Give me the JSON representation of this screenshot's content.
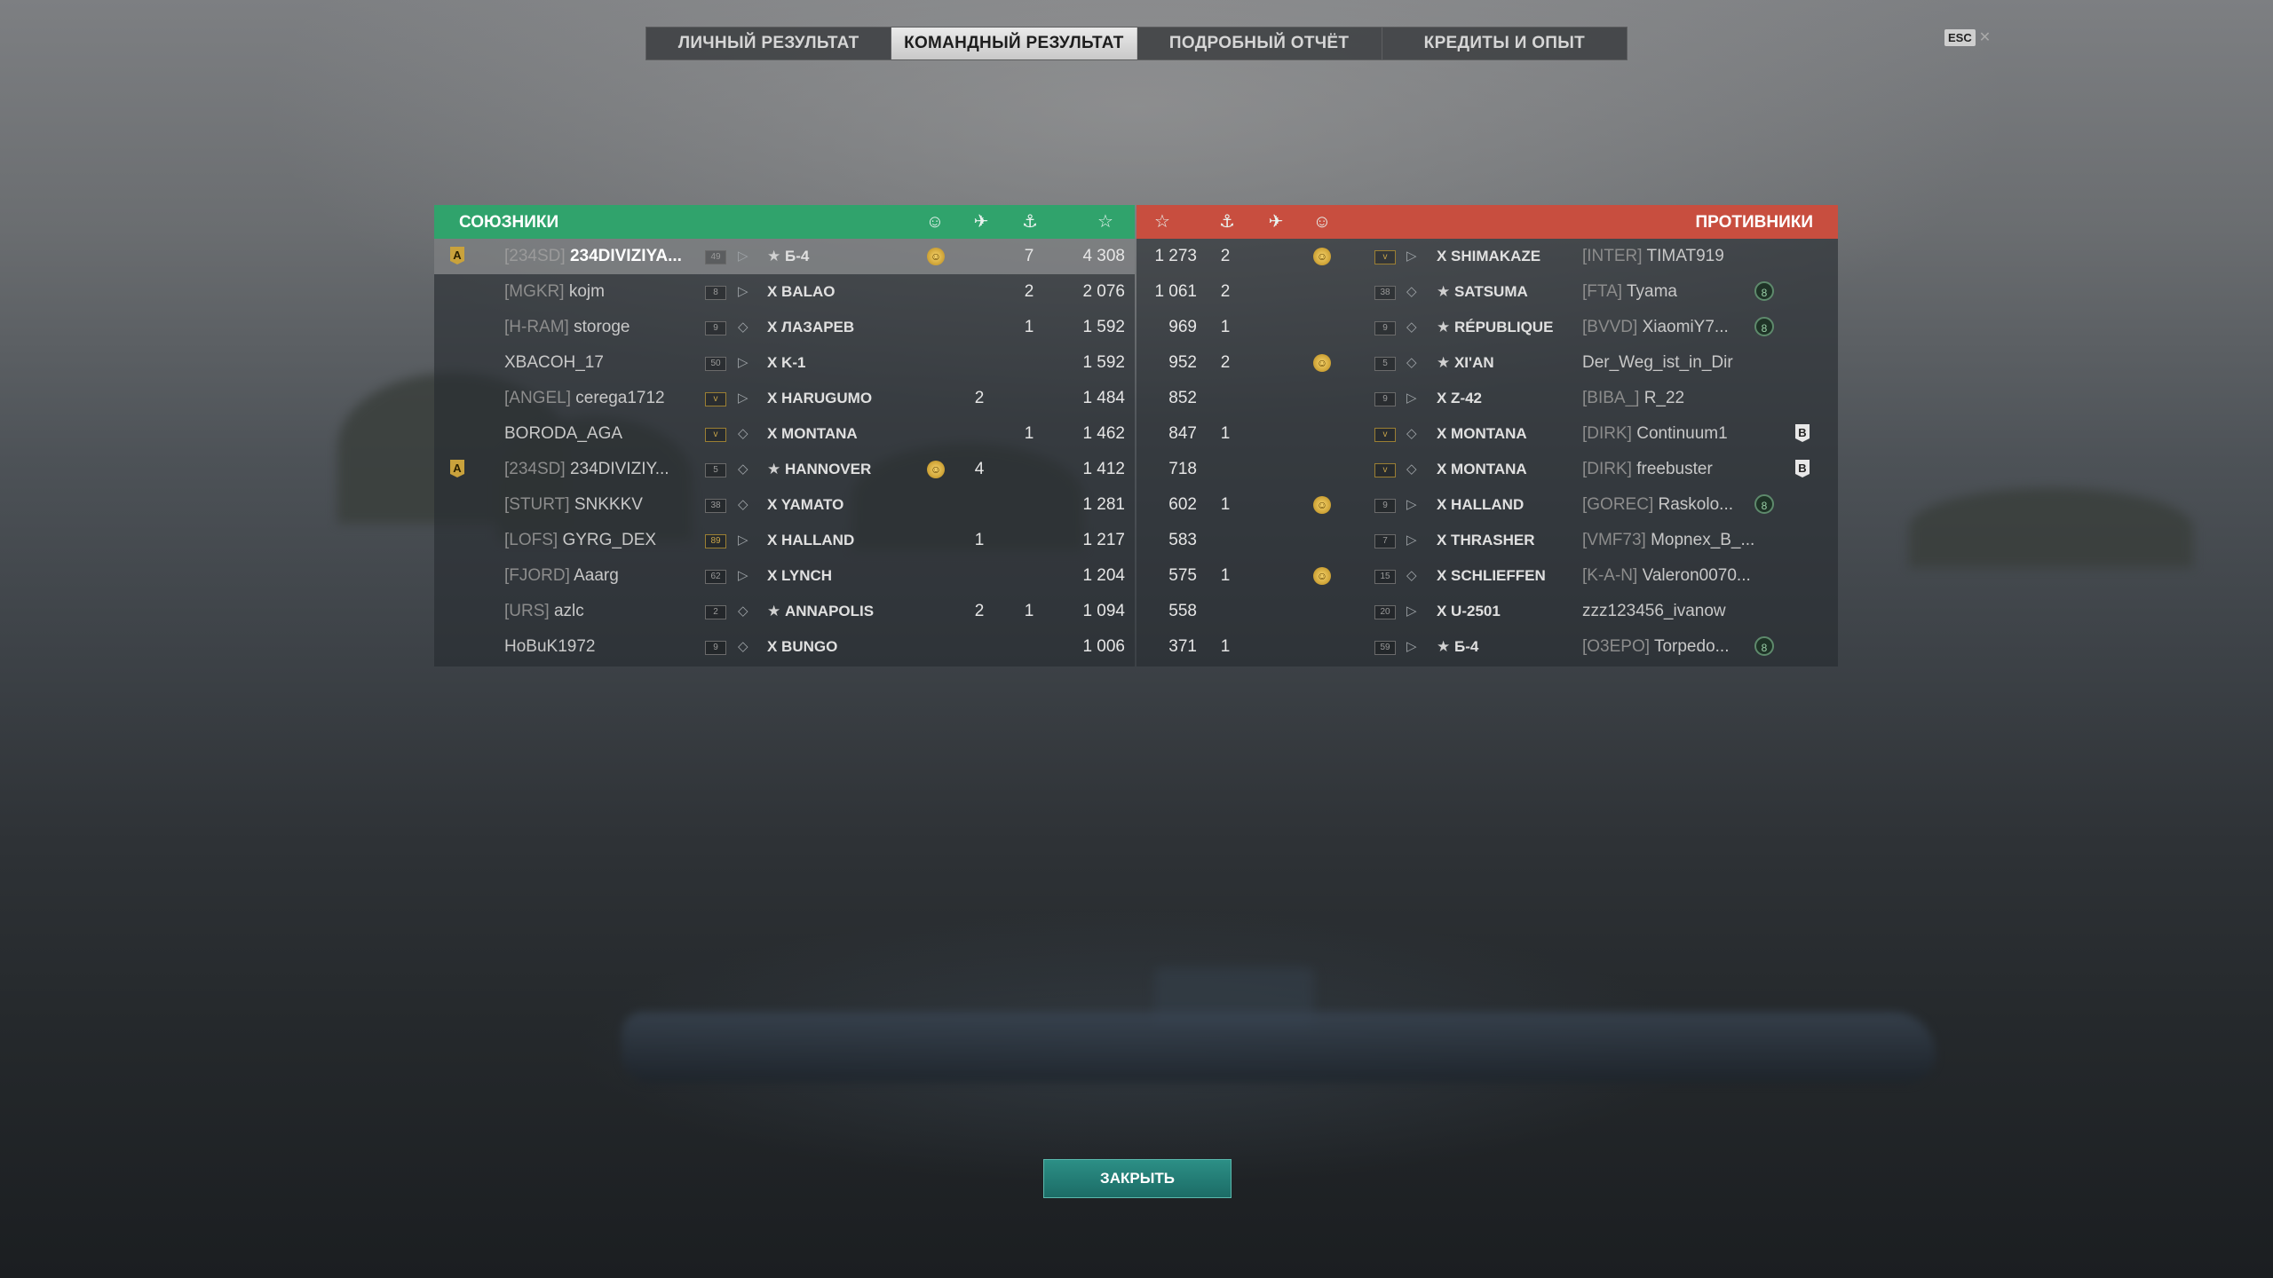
{
  "tabs": [
    {
      "label": "ЛИЧНЫЙ РЕЗУЛЬТАТ"
    },
    {
      "label": "КОМАНДНЫЙ РЕЗУЛЬТАТ"
    },
    {
      "label": "ПОДРОБНЫЙ ОТЧЁТ"
    },
    {
      "label": "КРЕДИТЫ И ОПЫТ"
    }
  ],
  "active_tab": 1,
  "esc_label": "ESC",
  "allies": {
    "title": "СОЮЗНИКИ",
    "header_icons": [
      "laurel-icon",
      "planes-icon",
      "ship-sunk-icon",
      "star-icon"
    ],
    "color": "#30a36c",
    "rows": [
      {
        "clan": "[234SD]",
        "name": "234DIVIZIYA...",
        "level": "49",
        "cls": "submarine-icon",
        "star": true,
        "ship": "Б-4",
        "laurel": true,
        "planes": "",
        "kills": "7",
        "xp": "4 308",
        "highlight": true,
        "rank": "A"
      },
      {
        "clan": "[MGKR]",
        "name": "kojm",
        "level": "8",
        "cls": "submarine-icon",
        "star": false,
        "ship": "X BALAO",
        "laurel": false,
        "planes": "",
        "kills": "2",
        "xp": "2 076"
      },
      {
        "clan": "[H-RAM]",
        "name": "storoge",
        "level": "9",
        "cls": "battleship-icon",
        "star": false,
        "ship": "X ЛАЗАРЕВ",
        "laurel": false,
        "planes": "",
        "kills": "1",
        "xp": "1 592"
      },
      {
        "clan": "",
        "name": "XBACOH_17",
        "level": "50",
        "cls": "submarine-icon",
        "star": false,
        "ship": "X K-1",
        "laurel": false,
        "planes": "",
        "kills": "",
        "xp": "1 592"
      },
      {
        "clan": "[ANGEL]",
        "name": "cerega1712",
        "level": "v",
        "cls": "destroyer-icon",
        "star": false,
        "ship": "X HARUGUMO",
        "laurel": false,
        "planes": "2",
        "kills": "",
        "xp": "1 484",
        "gold_badge": true
      },
      {
        "clan": "",
        "name": "BORODA_AGA",
        "level": "v",
        "cls": "battleship-icon",
        "star": false,
        "ship": "X MONTANA",
        "laurel": false,
        "planes": "",
        "kills": "1",
        "xp": "1 462",
        "gold_badge": true
      },
      {
        "clan": "[234SD]",
        "name": "234DIVIZIY...",
        "level": "5",
        "cls": "battleship-icon",
        "star": true,
        "ship": "HANNOVER",
        "laurel": true,
        "planes": "4",
        "kills": "",
        "xp": "1 412",
        "rank": "A"
      },
      {
        "clan": "[STURT]",
        "name": "SNKKKV",
        "level": "38",
        "cls": "battleship-icon",
        "star": false,
        "ship": "X YAMATO",
        "laurel": false,
        "planes": "",
        "kills": "",
        "xp": "1 281"
      },
      {
        "clan": "[LOFS]",
        "name": "GYRG_DEX",
        "level": "89",
        "cls": "destroyer-icon",
        "star": false,
        "ship": "X HALLAND",
        "laurel": false,
        "planes": "1",
        "kills": "",
        "xp": "1 217",
        "gold_badge": true
      },
      {
        "clan": "[FJORD]",
        "name": "Aaarg",
        "level": "62",
        "cls": "destroyer-icon",
        "star": false,
        "ship": "X LYNCH",
        "laurel": false,
        "planes": "",
        "kills": "",
        "xp": "1 204"
      },
      {
        "clan": "[URS]",
        "name": "azlc",
        "level": "2",
        "cls": "battleship-icon",
        "star": true,
        "ship": "ANNAPOLIS",
        "laurel": false,
        "planes": "2",
        "kills": "1",
        "xp": "1 094"
      },
      {
        "clan": "",
        "name": "HoBuK1972",
        "level": "9",
        "cls": "battleship-icon",
        "star": false,
        "ship": "X BUNGO",
        "laurel": false,
        "planes": "",
        "kills": "",
        "xp": "1 006"
      }
    ]
  },
  "enemies": {
    "title": "ПРОТИВНИКИ",
    "header_icons": [
      "star-icon",
      "ship-sunk-icon",
      "planes-icon",
      "laurel-icon"
    ],
    "color": "#c84e3f",
    "rows": [
      {
        "xp": "1 273",
        "kills": "2",
        "planes": "",
        "laurel": true,
        "level": "v",
        "cls": "destroyer-icon",
        "star": false,
        "ship": "X SHIMAKAZE",
        "clan": "[INTER]",
        "name": "TIMAT919",
        "extra": "",
        "gold_badge": true
      },
      {
        "xp": "1 061",
        "kills": "2",
        "planes": "",
        "laurel": false,
        "level": "38",
        "cls": "battleship-icon",
        "star": true,
        "ship": "SATSUMA",
        "clan": "[FTA]",
        "name": "Tyama",
        "extra": "circle"
      },
      {
        "xp": "969",
        "kills": "1",
        "planes": "",
        "laurel": false,
        "level": "9",
        "cls": "battleship-icon",
        "star": true,
        "ship": "RÉPUBLIQUE",
        "clan": "[BVVD]",
        "name": "XiaomiY7...",
        "extra": "circle"
      },
      {
        "xp": "952",
        "kills": "2",
        "planes": "",
        "laurel": true,
        "level": "5",
        "cls": "battleship-icon",
        "star": true,
        "ship": "XI'AN",
        "clan": "",
        "name": "Der_Weg_ist_in_Dir",
        "extra": ""
      },
      {
        "xp": "852",
        "kills": "",
        "planes": "",
        "laurel": false,
        "level": "9",
        "cls": "destroyer-icon",
        "star": false,
        "ship": "X Z-42",
        "clan": "[BIBA_]",
        "name": "R_22",
        "extra": ""
      },
      {
        "xp": "847",
        "kills": "1",
        "planes": "",
        "laurel": false,
        "level": "v",
        "cls": "battleship-icon",
        "star": false,
        "ship": "X MONTANA",
        "clan": "[DIRK]",
        "name": "Continuum1",
        "extra": "shield",
        "gold_badge": true
      },
      {
        "xp": "718",
        "kills": "",
        "planes": "",
        "laurel": false,
        "level": "v",
        "cls": "battleship-icon",
        "star": false,
        "ship": "X MONTANA",
        "clan": "[DIRK]",
        "name": "freebuster",
        "extra": "shield",
        "gold_badge": true
      },
      {
        "xp": "602",
        "kills": "1",
        "planes": "",
        "laurel": true,
        "level": "9",
        "cls": "destroyer-icon",
        "star": false,
        "ship": "X HALLAND",
        "clan": "[GOREC]",
        "name": "Raskolo...",
        "extra": "circle"
      },
      {
        "xp": "583",
        "kills": "",
        "planes": "",
        "laurel": false,
        "level": "7",
        "cls": "destroyer-icon",
        "star": false,
        "ship": "X THRASHER",
        "clan": "[VMF73]",
        "name": "Mopnex_B_...",
        "extra": ""
      },
      {
        "xp": "575",
        "kills": "1",
        "planes": "",
        "laurel": true,
        "level": "15",
        "cls": "battleship-icon",
        "star": false,
        "ship": "X SCHLIEFFEN",
        "clan": "[K-A-N]",
        "name": "Valeron0070...",
        "extra": ""
      },
      {
        "xp": "558",
        "kills": "",
        "planes": "",
        "laurel": false,
        "level": "20",
        "cls": "submarine-icon",
        "star": false,
        "ship": "X U-2501",
        "clan": "",
        "name": "zzz123456_ivanow",
        "extra": ""
      },
      {
        "xp": "371",
        "kills": "1",
        "planes": "",
        "laurel": false,
        "level": "59",
        "cls": "submarine-icon",
        "star": true,
        "ship": "Б-4",
        "clan": "[O3EPO]",
        "name": "Torpedo...",
        "extra": "circle"
      }
    ]
  },
  "close_button": "ЗАКРЫТЬ"
}
